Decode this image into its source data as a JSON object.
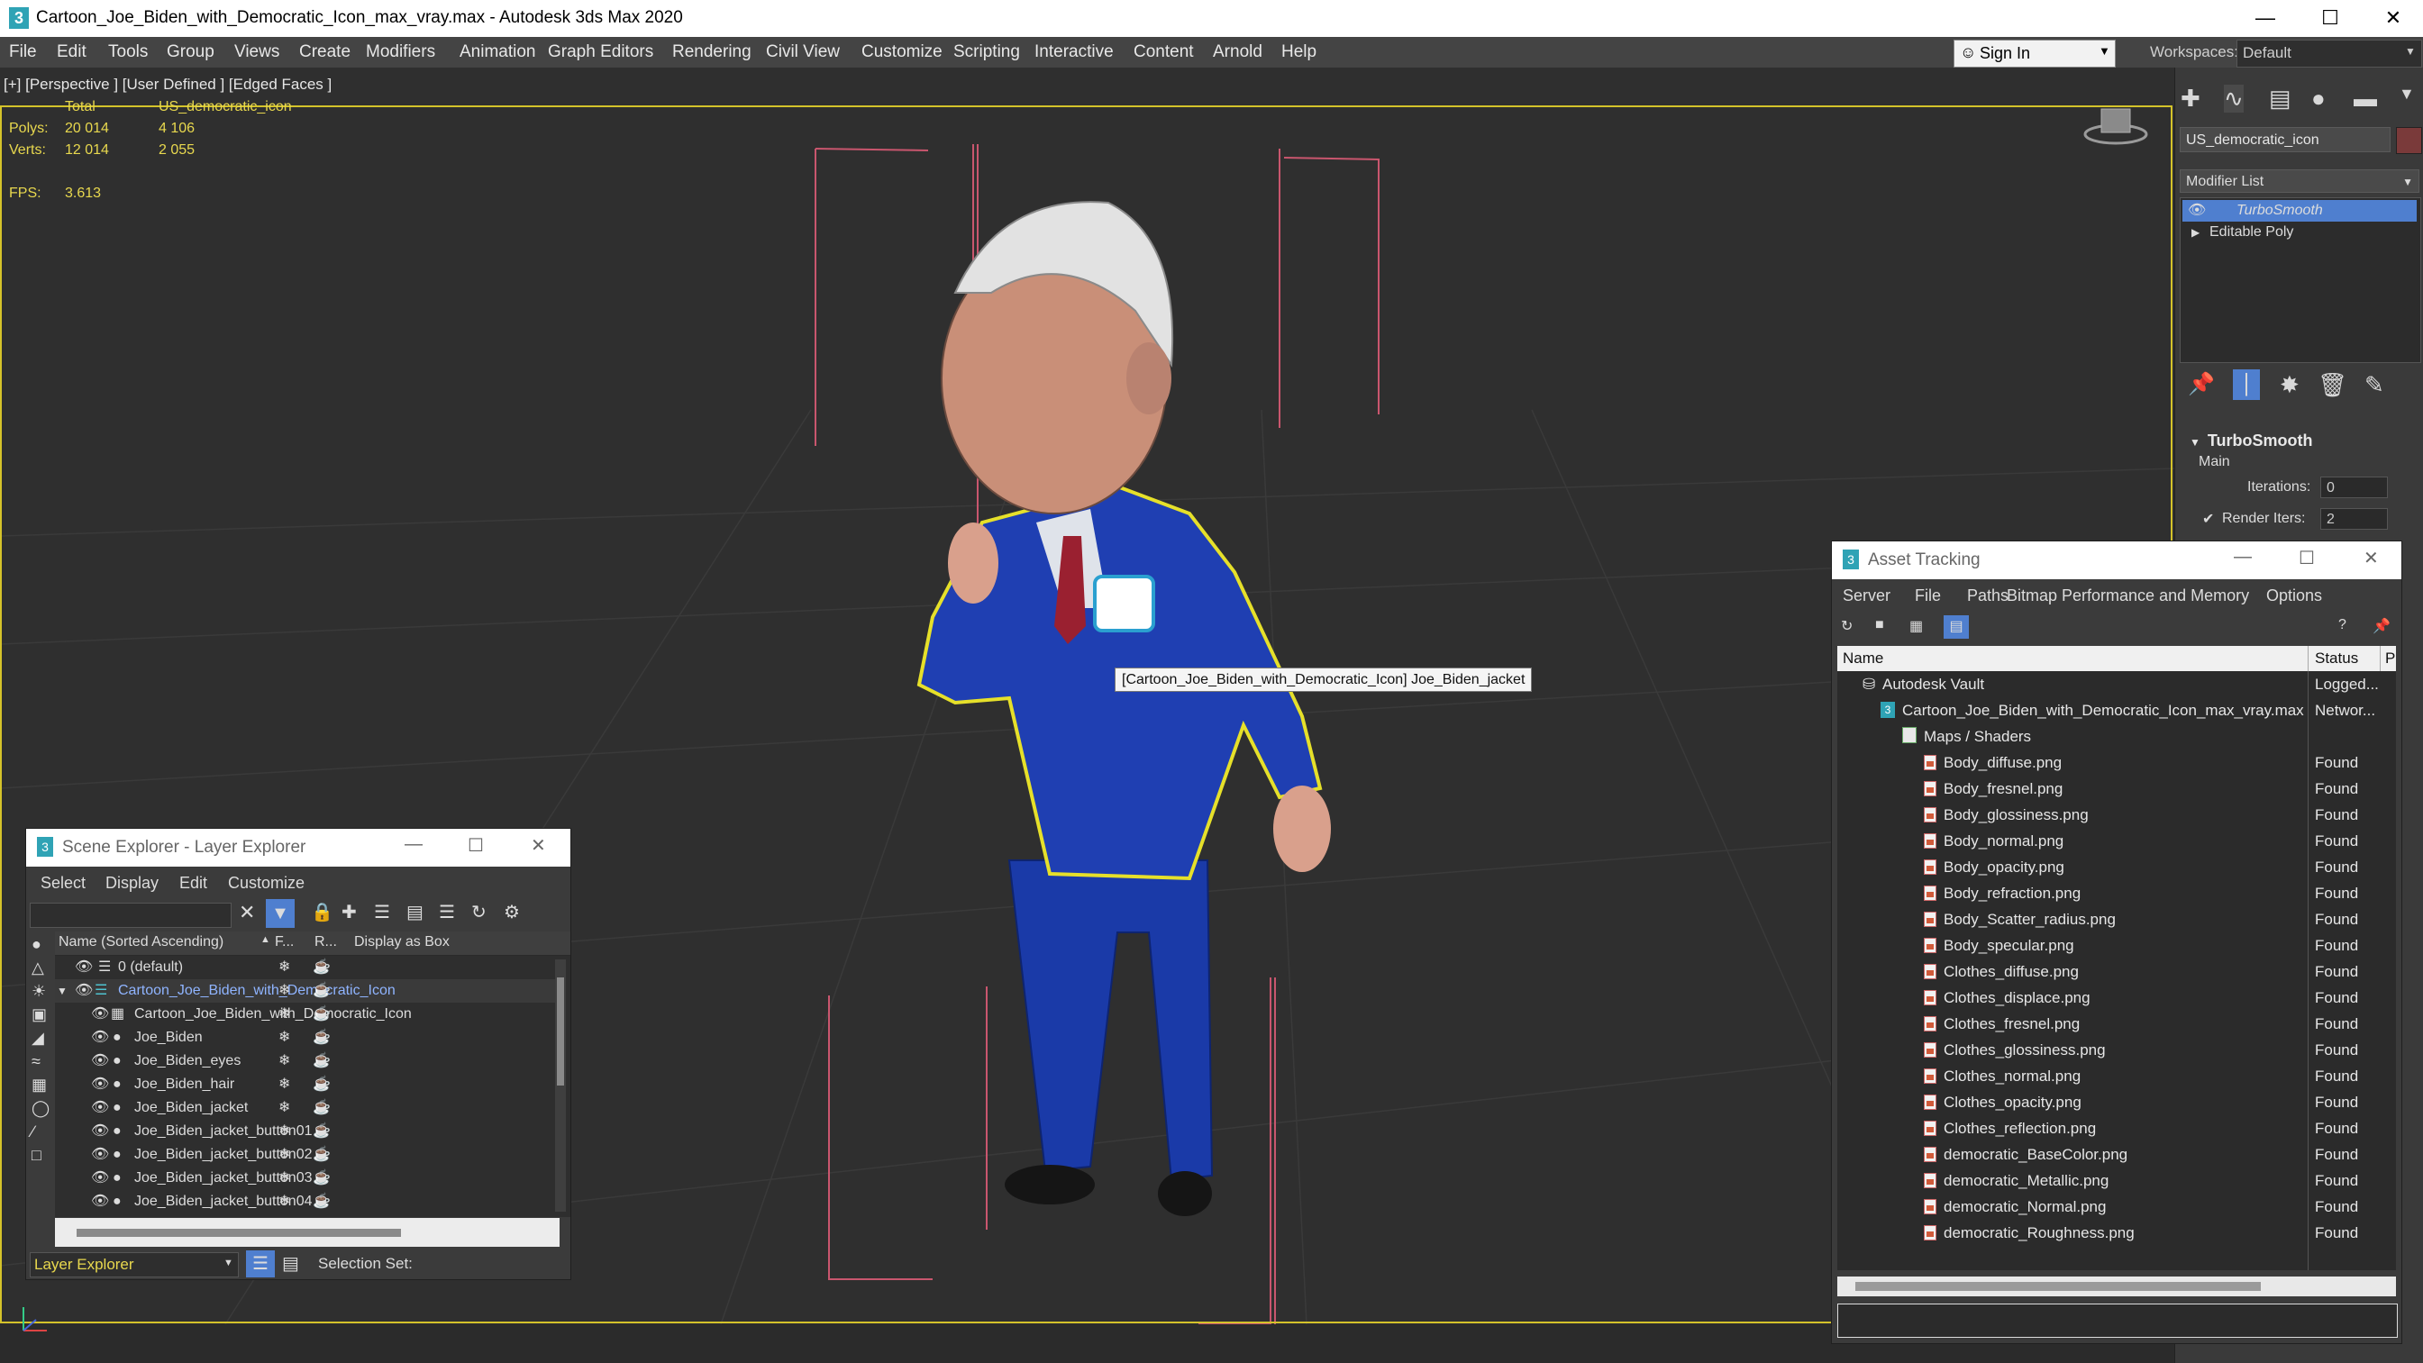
{
  "window": {
    "title": "Cartoon_Joe_Biden_with_Democratic_Icon_max_vray.max - Autodesk 3ds Max 2020",
    "app_icon_text": "3",
    "minimize": "—",
    "maximize": "☐",
    "close": "✕"
  },
  "menu": [
    "File",
    "Edit",
    "Tools",
    "Group",
    "Views",
    "Create",
    "Modifiers",
    "Animation",
    "Graph Editors",
    "Rendering",
    "Civil View",
    "Customize",
    "Scripting",
    "Interactive",
    "Content",
    "Arnold",
    "Help"
  ],
  "signin": {
    "label": "Sign In"
  },
  "workspaces": {
    "label": "Workspaces:",
    "value": "Default"
  },
  "viewport": {
    "label": "[+] [Perspective ] [User Defined ] [Edged Faces ]",
    "stats": {
      "total_header": "Total",
      "object_header": "US_democratic_icon",
      "polys_label": "Polys:",
      "polys_total": "20 014",
      "polys_obj": "4 106",
      "verts_label": "Verts:",
      "verts_total": "12 014",
      "verts_obj": "2 055",
      "fps_label": "FPS:",
      "fps_value": "3.613"
    },
    "tooltip": "[Cartoon_Joe_Biden_with_Democratic_Icon] Joe_Biden_jacket"
  },
  "command_panel": {
    "object_name": "US_democratic_icon",
    "modifier_list": "Modifier List",
    "stack": [
      "TurboSmooth",
      "Editable Poly"
    ],
    "rollout_title": "TurboSmooth",
    "section": "Main",
    "iterations_label": "Iterations:",
    "iterations_value": "0",
    "render_iters_label": "Render Iters:",
    "render_iters_value": "2"
  },
  "scene_explorer": {
    "title": "Scene Explorer - Layer Explorer",
    "menu": [
      "Select",
      "Display",
      "Edit",
      "Customize"
    ],
    "columns": [
      "Name (Sorted Ascending)",
      "F...",
      "R...",
      "Display as Box"
    ],
    "rows": [
      {
        "name": "0 (default)"
      },
      {
        "name": "Cartoon_Joe_Biden_with_Democratic_Icon"
      },
      {
        "name": "Cartoon_Joe_Biden_with_Democratic_Icon"
      },
      {
        "name": "Joe_Biden"
      },
      {
        "name": "Joe_Biden_eyes"
      },
      {
        "name": "Joe_Biden_hair"
      },
      {
        "name": "Joe_Biden_jacket"
      },
      {
        "name": "Joe_Biden_jacket_button01"
      },
      {
        "name": "Joe_Biden_jacket_button02"
      },
      {
        "name": "Joe_Biden_jacket_button03"
      },
      {
        "name": "Joe_Biden_jacket_button04"
      }
    ],
    "bottom_dropdown": "Layer Explorer",
    "selection_set_label": "Selection Set:"
  },
  "asset_tracking": {
    "title": "Asset Tracking",
    "menu": [
      "Server",
      "File",
      "Paths",
      "Bitmap Performance and Memory",
      "Options"
    ],
    "columns": [
      "Name",
      "Status",
      "P"
    ],
    "rows": [
      {
        "name": "Autodesk Vault",
        "status": "Logged..."
      },
      {
        "name": "Cartoon_Joe_Biden_with_Democratic_Icon_max_vray.max",
        "status": "Networ..."
      },
      {
        "name": "Maps / Shaders",
        "status": ""
      },
      {
        "name": "Body_diffuse.png",
        "status": "Found"
      },
      {
        "name": "Body_fresnel.png",
        "status": "Found"
      },
      {
        "name": "Body_glossiness.png",
        "status": "Found"
      },
      {
        "name": "Body_normal.png",
        "status": "Found"
      },
      {
        "name": "Body_opacity.png",
        "status": "Found"
      },
      {
        "name": "Body_refraction.png",
        "status": "Found"
      },
      {
        "name": "Body_Scatter_radius.png",
        "status": "Found"
      },
      {
        "name": "Body_specular.png",
        "status": "Found"
      },
      {
        "name": "Clothes_diffuse.png",
        "status": "Found"
      },
      {
        "name": "Clothes_displace.png",
        "status": "Found"
      },
      {
        "name": "Clothes_fresnel.png",
        "status": "Found"
      },
      {
        "name": "Clothes_glossiness.png",
        "status": "Found"
      },
      {
        "name": "Clothes_normal.png",
        "status": "Found"
      },
      {
        "name": "Clothes_opacity.png",
        "status": "Found"
      },
      {
        "name": "Clothes_reflection.png",
        "status": "Found"
      },
      {
        "name": "democratic_BaseColor.png",
        "status": "Found"
      },
      {
        "name": "democratic_Metallic.png",
        "status": "Found"
      },
      {
        "name": "democratic_Normal.png",
        "status": "Found"
      },
      {
        "name": "democratic_Roughness.png",
        "status": "Found"
      }
    ]
  },
  "colors": {
    "viewport_bg": "#2f2f2f",
    "selection_outline": "#e6e02a",
    "suit_blue": "#1e3fb0",
    "bbox_pink": "#c9566e",
    "stat_yellow": "#e8d84e",
    "stack_highlight": "#4f7fcf"
  }
}
